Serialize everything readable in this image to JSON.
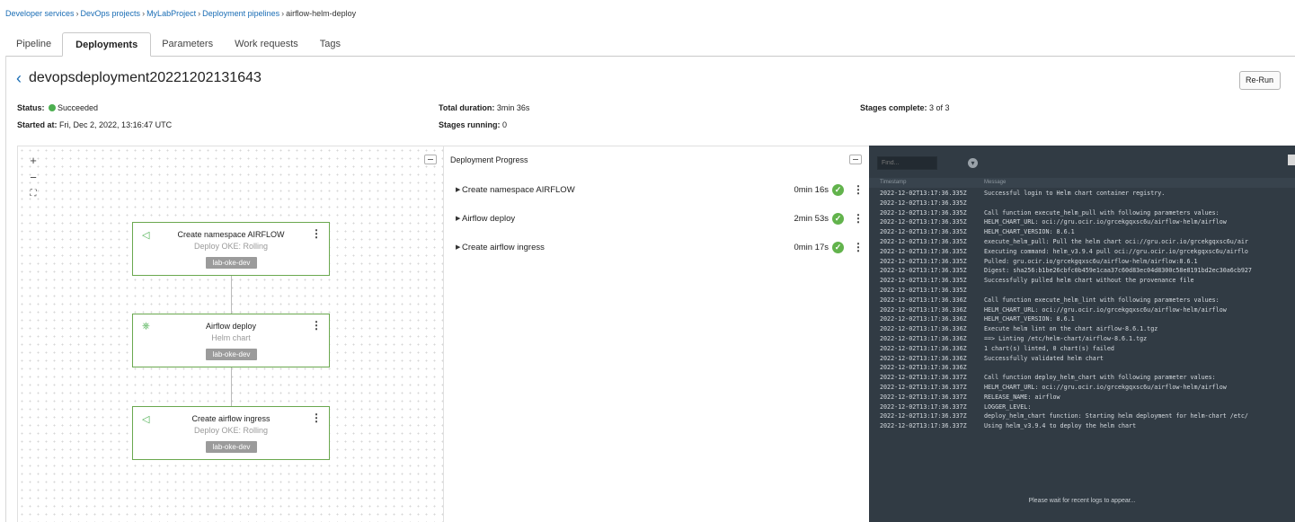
{
  "breadcrumb": [
    {
      "label": "Developer services",
      "link": true
    },
    {
      "label": "DevOps projects",
      "link": true
    },
    {
      "label": "MyLabProject",
      "link": true
    },
    {
      "label": "Deployment pipelines",
      "link": true
    },
    {
      "label": "airflow-helm-deploy",
      "link": false
    }
  ],
  "breadcrumb_separator": "›",
  "tabs": [
    {
      "label": "Pipeline",
      "active": false
    },
    {
      "label": "Deployments",
      "active": true
    },
    {
      "label": "Parameters",
      "active": false
    },
    {
      "label": "Work requests",
      "active": false
    },
    {
      "label": "Tags",
      "active": false
    }
  ],
  "deployment": {
    "back_icon": "chevron-left-icon",
    "title": "devopsdeployment20221202131643",
    "rerun_label": "Re-Run",
    "status_label": "Status:",
    "status_value": "Succeeded",
    "status_color": "#4caf50",
    "started_label": "Started at:",
    "started_value": "Fri, Dec 2, 2022, 13:16:47 UTC",
    "duration_label": "Total duration:",
    "duration_value": "3min 36s",
    "running_label": "Stages running:",
    "running_value": "0",
    "complete_label": "Stages complete:",
    "complete_value": "3 of 3"
  },
  "graph": {
    "zoom_in": "+",
    "zoom_out": "−",
    "fit": "⛶",
    "nodes": [
      {
        "title": "Create namespace AIRFLOW",
        "subtitle": "Deploy OKE: Rolling",
        "tag": "lab-oke-dev",
        "icon": "paper-plane-icon",
        "icon_glyph": "◁"
      },
      {
        "title": "Airflow deploy",
        "subtitle": "Helm chart",
        "tag": "lab-oke-dev",
        "icon": "helm-icon",
        "icon_glyph": "⎈"
      },
      {
        "title": "Create airflow ingress",
        "subtitle": "Deploy OKE: Rolling",
        "tag": "lab-oke-dev",
        "icon": "paper-plane-icon",
        "icon_glyph": "◁"
      }
    ],
    "accent_color": "#6aa84f"
  },
  "progress": {
    "title": "Deployment Progress",
    "stages": [
      {
        "label": "Create namespace AIRFLOW",
        "duration": "0min 16s"
      },
      {
        "label": "Airflow deploy",
        "duration": "2min 53s"
      },
      {
        "label": "Create airflow ingress",
        "duration": "0min 17s"
      }
    ]
  },
  "logs": {
    "find_placeholder": "Find...",
    "col_timestamp": "Timestamp",
    "col_message": "Message",
    "wait_message": "Please wait for recent logs to appear...",
    "lines": [
      {
        "ts": "2022-12-02T13:17:36.335Z",
        "msg": "Successful login to Helm chart container registry."
      },
      {
        "ts": "2022-12-02T13:17:36.335Z",
        "msg": ""
      },
      {
        "ts": "2022-12-02T13:17:36.335Z",
        "msg": " Call function execute_helm_pull with following parameters values:"
      },
      {
        "ts": "2022-12-02T13:17:36.335Z",
        "msg": " HELM_CHART_URL: oci://gru.ocir.io/grcekgqxsc6u/airflow-helm/airflow"
      },
      {
        "ts": "2022-12-02T13:17:36.335Z",
        "msg": " HELM_CHART_VERSION: 8.6.1"
      },
      {
        "ts": "2022-12-02T13:17:36.335Z",
        "msg": " execute_helm_pull: Pull the helm chart oci://gru.ocir.io/grcekgqxsc6u/air"
      },
      {
        "ts": "2022-12-02T13:17:36.335Z",
        "msg": " Executing command: helm_v3.9.4 pull oci://gru.ocir.io/grcekgqxsc6u/airflo"
      },
      {
        "ts": "2022-12-02T13:17:36.335Z",
        "msg": "Pulled: gru.ocir.io/grcekgqxsc6u/airflow-helm/airflow:8.6.1"
      },
      {
        "ts": "2022-12-02T13:17:36.335Z",
        "msg": "Digest: sha256:b1be26cbfc0b459e1caa37c60d83ec04d8300c58e8191bd2ec30a6cb927"
      },
      {
        "ts": "2022-12-02T13:17:36.335Z",
        "msg": " Successfully pulled helm chart without the provenance file"
      },
      {
        "ts": "2022-12-02T13:17:36.335Z",
        "msg": ""
      },
      {
        "ts": "2022-12-02T13:17:36.336Z",
        "msg": " Call function execute_helm_lint with following parameters values:"
      },
      {
        "ts": "2022-12-02T13:17:36.336Z",
        "msg": " HELM_CHART_URL: oci://gru.ocir.io/grcekgqxsc6u/airflow-helm/airflow"
      },
      {
        "ts": "2022-12-02T13:17:36.336Z",
        "msg": " HELM_CHART_VERSION: 8.6.1"
      },
      {
        "ts": "2022-12-02T13:17:36.336Z",
        "msg": " Execute helm lint on the chart airflow-8.6.1.tgz"
      },
      {
        "ts": "2022-12-02T13:17:36.336Z",
        "msg": "==> Linting /etc/helm-chart/airflow-8.6.1.tgz"
      },
      {
        "ts": "2022-12-02T13:17:36.336Z",
        "msg": "1 chart(s) linted, 0 chart(s) failed"
      },
      {
        "ts": "2022-12-02T13:17:36.336Z",
        "msg": " Successfully validated helm chart"
      },
      {
        "ts": "2022-12-02T13:17:36.336Z",
        "msg": ""
      },
      {
        "ts": "2022-12-02T13:17:36.337Z",
        "msg": " Call function deploy_helm_chart with following parameter values:"
      },
      {
        "ts": "2022-12-02T13:17:36.337Z",
        "msg": " HELM_CHART_URL: oci://gru.ocir.io/grcekgqxsc6u/airflow-helm/airflow"
      },
      {
        "ts": "2022-12-02T13:17:36.337Z",
        "msg": " RELEASE_NAME: airflow"
      },
      {
        "ts": "2022-12-02T13:17:36.337Z",
        "msg": " LOGGER_LEVEL:"
      },
      {
        "ts": "2022-12-02T13:17:36.337Z",
        "msg": " deploy_helm_chart function: Starting helm deployment for helm-chart /etc/"
      },
      {
        "ts": "2022-12-02T13:17:36.337Z",
        "msg": " Using helm_v3.9.4 to deploy the helm chart"
      }
    ]
  }
}
